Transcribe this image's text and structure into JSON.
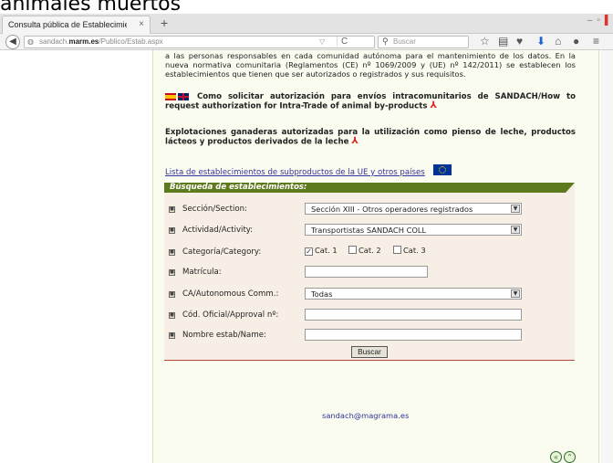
{
  "page_heading_fragment": "animales muertos",
  "browser": {
    "tab_title": "Consulta pública de Establecimient...",
    "tab_close": "×",
    "new_tab": "+",
    "window_controls": [
      "–",
      "▫"
    ],
    "url_prefix": "sandach.",
    "url_domain": "marm.es",
    "url_path": "/Publico/Estab.aspx",
    "search_placeholder": "Buscar"
  },
  "content": {
    "intro_text": "a las personas responsables en cada comunidad autónoma para el mantenimiento de los datos. En la nueva normativa comunitaria (Reglamentos (CE) nº 1069/2009 y (UE) nº 142/2011) se establecen los establecimientos que tienen que ser autorizados o registrados y sus requisitos.",
    "link_intra_trade": "Como solicitar autorización para envíos intracomunitarios de SANDACH/How to request authorization for Intra-Trade of animal by-products",
    "link_milk": "Explotaciones ganaderas autorizadas para la utilización como pienso de leche, productos lácteos y productos derivados de la leche",
    "eu_list_link": "Lista de establecimientos de subproductos de la UE y otros países"
  },
  "search": {
    "header": "Búsqueda de establecimientos:",
    "section_label": "Sección/Section:",
    "section_value": "Sección XIII - Otros operadores registrados",
    "activity_label": "Actividad/Activity:",
    "activity_value": "Transportistas SANDACH COLL",
    "category_label": "Categoría/Category:",
    "cat1": "Cat. 1",
    "cat2": "Cat. 2",
    "cat3": "Cat. 3",
    "matricula_label": "Matrícula:",
    "ca_label": "CA/Autonomous Comm.:",
    "ca_value": "Todas",
    "cod_label": "Cód. Oficial/Approval nº:",
    "name_label": "Nombre estab/Name:",
    "button": "Buscar"
  },
  "footer": {
    "email": "sandach@magrama.es"
  }
}
